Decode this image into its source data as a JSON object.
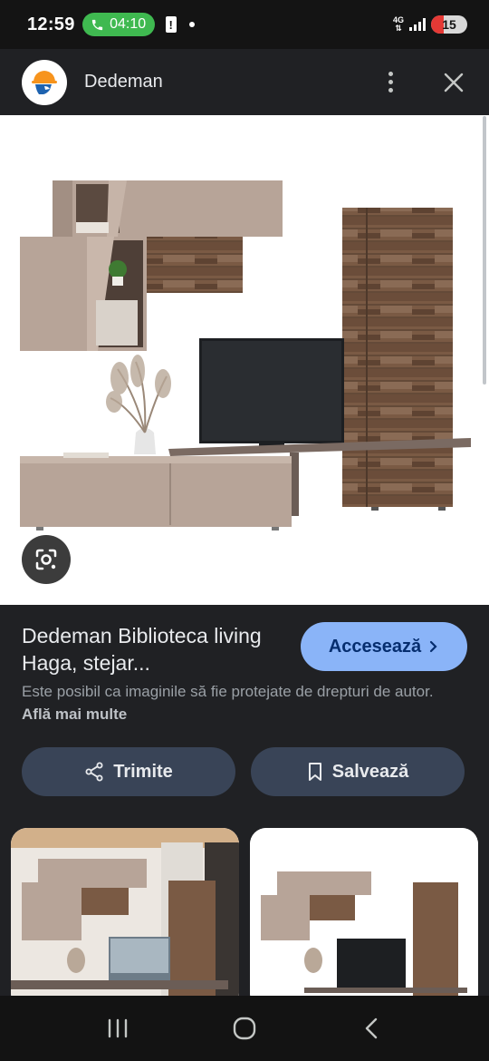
{
  "status_bar": {
    "time": "12:59",
    "call_duration": "04:10",
    "network": "4G",
    "battery": "15"
  },
  "header": {
    "site_name": "Dedeman",
    "logo_icon": "dedeman-logo",
    "menu_icon": "more-vert-icon",
    "close_icon": "close-icon"
  },
  "result": {
    "title": "Dedeman Biblioteca living Haga, stejar...",
    "visit_label": "Accesează",
    "copyright_text": "Este posibil ca imaginile să fie protejate de drepturi de autor.",
    "learn_more": "Află mai multe",
    "share_label": "Trimite",
    "save_label": "Salvează"
  },
  "colors": {
    "accent": "#8ab4f8",
    "action_button": "#394457",
    "background": "#202124"
  },
  "nav": {
    "recents_icon": "recents-icon",
    "home_icon": "home-icon",
    "back_icon": "back-icon"
  }
}
